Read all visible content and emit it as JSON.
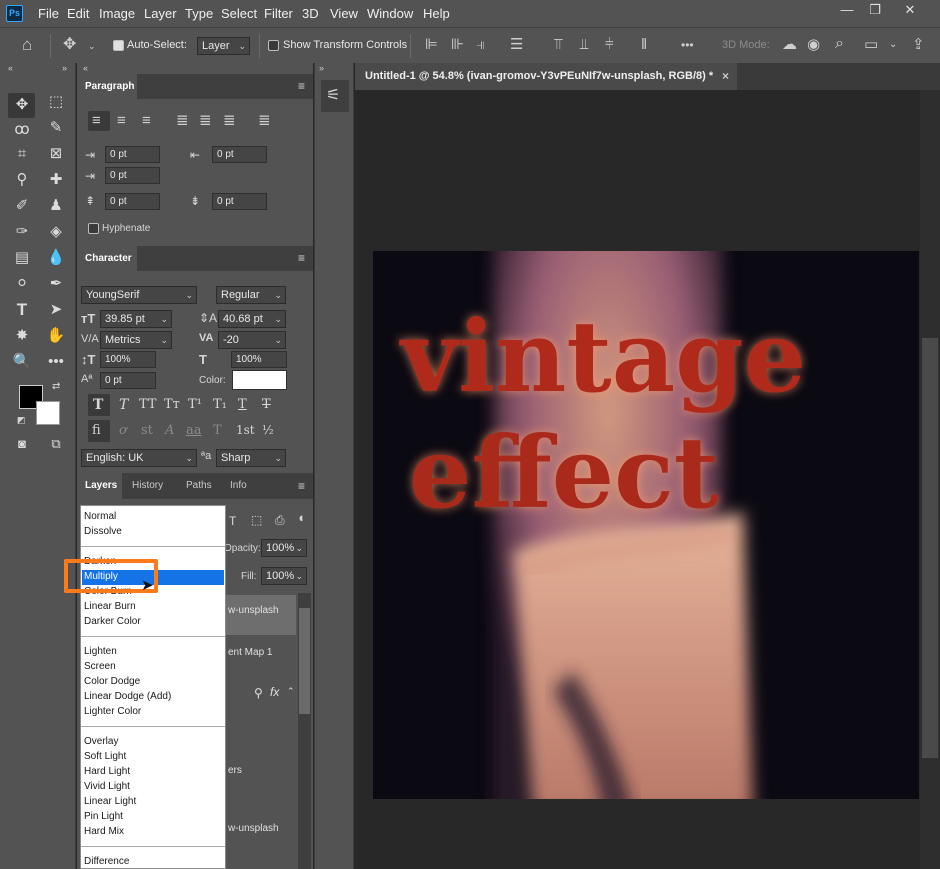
{
  "app": {
    "logo": "Ps"
  },
  "menu": [
    "File",
    "Edit",
    "Image",
    "Layer",
    "Type",
    "Select",
    "Filter",
    "3D",
    "View",
    "Window",
    "Help"
  ],
  "window_controls": {
    "minimize": "—",
    "restore": "❐",
    "close": "✕"
  },
  "options": {
    "auto_select_label": "Auto-Select:",
    "auto_select_target": "Layer",
    "show_transform_label": "Show Transform Controls",
    "more": "•••",
    "mode_3d": "3D Mode:"
  },
  "paragraph": {
    "title": "Paragraph",
    "indent_left": "0 pt",
    "indent_right": "0 pt",
    "indent_first": "0 pt",
    "space_before": "0 pt",
    "space_after": "0 pt",
    "hyphenate_label": "Hyphenate"
  },
  "character": {
    "title": "Character",
    "font_family": "YoungSerif",
    "font_style": "Regular",
    "font_size": "39.85 pt",
    "leading": "40.68 pt",
    "kerning": "Metrics",
    "tracking": "-20",
    "vscale": "100%",
    "hscale": "100%",
    "baseline": "0 pt",
    "color_label": "Color:",
    "language": "English: UK",
    "aa_label": "ªa",
    "antialias": "Sharp",
    "style_buttons": [
      "T",
      "T",
      "TT",
      "Tт",
      "T¹",
      "T₁",
      "T",
      "T"
    ],
    "opentype_buttons": [
      "fi",
      "ơ",
      "st",
      "A",
      "aa",
      "T",
      "1st",
      "½"
    ]
  },
  "layers_tabs": [
    "Layers",
    "History",
    "Paths",
    "Info"
  ],
  "layers": {
    "opacity_label": "Opacity:",
    "opacity": "100%",
    "fill_label": "Fill:",
    "fill": "100%",
    "rows": [
      "w-unsplash",
      "ent Map 1",
      "ers",
      "w-unsplash"
    ],
    "fx": "fx"
  },
  "blend_modes": {
    "selected": "Multiply",
    "groups": [
      [
        "Normal",
        "Dissolve"
      ],
      [
        "Darken",
        "Multiply",
        "Color Burn",
        "Linear Burn",
        "Darker Color"
      ],
      [
        "Lighten",
        "Screen",
        "Color Dodge",
        "Linear Dodge (Add)",
        "Lighter Color"
      ],
      [
        "Overlay",
        "Soft Light",
        "Hard Light",
        "Vivid Light",
        "Linear Light",
        "Pin Light",
        "Hard Mix"
      ],
      [
        "Difference"
      ]
    ]
  },
  "document": {
    "tab_title": "Untitled-1 @ 54.8% (ivan-gromov-Y3vPEuNIf7w-unsplash, RGB/8) *",
    "close": "×"
  },
  "artwork": {
    "line1": "vintage",
    "line2": "effect"
  },
  "colors": {
    "accent": "#31a8ff",
    "highlight": "#ff7a1a",
    "selection": "#1473e6",
    "text_red": "#b02a1c"
  }
}
